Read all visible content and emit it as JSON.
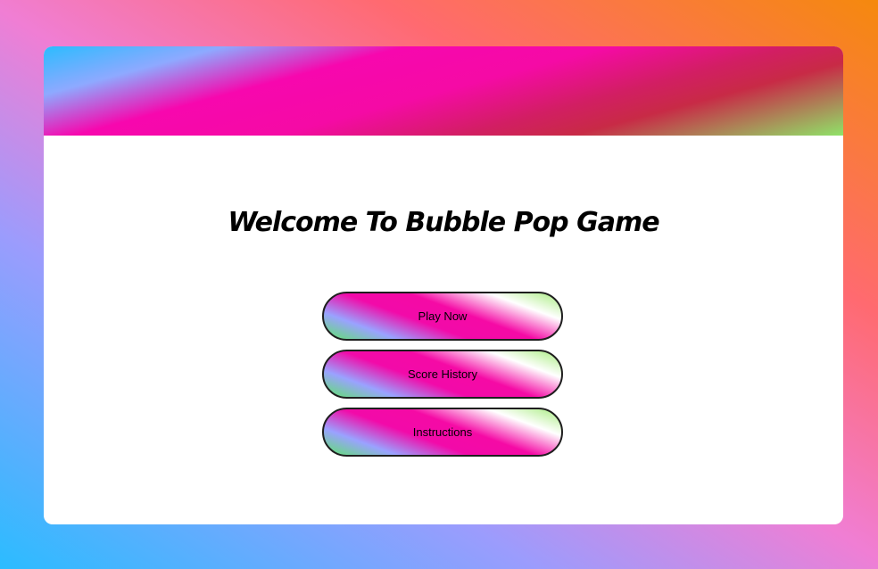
{
  "game": {
    "title": "Welcome To Bubble Pop Game"
  },
  "menu": {
    "buttons": [
      {
        "label": "Play Now"
      },
      {
        "label": "Score History"
      },
      {
        "label": "Instructions"
      }
    ]
  },
  "colors": {
    "background_gradient": [
      "#2bbcff",
      "#9b9cfd",
      "#f07ed4",
      "#ff6a70",
      "#f5890d"
    ],
    "header_gradient": [
      "#2bbcff",
      "#8ea9ff",
      "#f707ae",
      "#c82a46",
      "#8fe368"
    ],
    "button_gradient": [
      "#a8ec80",
      "#ffffff",
      "#f50aa5",
      "#9aa2ff",
      "#5ee36b"
    ],
    "card": "#ffffff",
    "text": "#000000"
  }
}
